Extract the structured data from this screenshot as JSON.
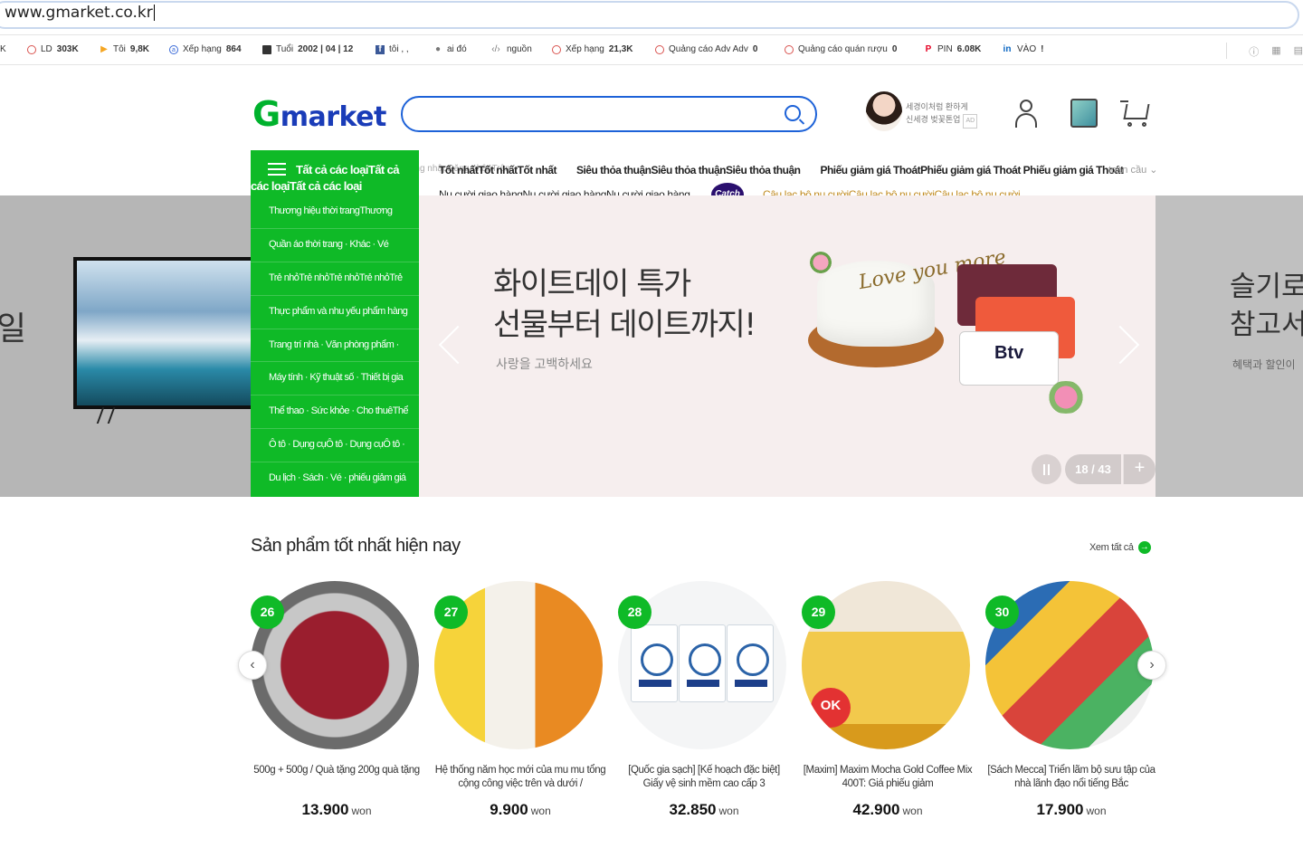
{
  "browser": {
    "url": "www.gmarket.co.kr",
    "bookmarks": [
      {
        "label": "LD",
        "value": "303K"
      },
      {
        "label": "Tôi",
        "value": "9,8K"
      },
      {
        "label": "Xếp hạng",
        "value": "864"
      },
      {
        "label": "Tuổi",
        "value": "2002 | 04 | 12"
      },
      {
        "label": "tôi , ,",
        "value": ""
      },
      {
        "label": "ai đó",
        "value": ""
      },
      {
        "label": "nguồn",
        "value": ""
      },
      {
        "label": "Xếp hạng",
        "value": "21,3K"
      },
      {
        "label": "Quảng cáo Adv Adv",
        "value": "0"
      },
      {
        "label": "Quảng cáo quán rượu",
        "value": "0"
      },
      {
        "label": "PIN",
        "value": "6.08K"
      },
      {
        "label": "VÀO",
        "value": "!"
      }
    ],
    "bookmark_first": "K"
  },
  "header": {
    "logo_g": "G",
    "logo_rest": "market",
    "search_placeholder": "",
    "ad": {
      "line1": "세경이처럼 환하게",
      "line2": "신세경 벚꽃톤업",
      "badge": "AD"
    }
  },
  "category": {
    "title": "Tất cả các loạiTất cả",
    "title2": "các loạiTất cả các loại",
    "items": [
      "Thương hiệu thời trangThương",
      "Quần áo thời trang · Khác · Vé",
      "Trẻ nhỏTrẻ nhỏTrẻ nhỏTrẻ nhỏTrẻ",
      "Thực phẩm và nhu yếu phẩm hàng",
      "Trang trí nhà · Văn phòng phẩm ·",
      "Máy tính · Kỹ thuật số · Thiết bị gia",
      "Thể thao · Sức khỏe · Cho thuêThể",
      "Ô tô · Dụng cụÔ tô · Dụng cụÔ tô ·",
      "Du lịch · Sách · Vé · phiếu giảm giá"
    ]
  },
  "topnav": {
    "ghost": "oopĐăng nhậpĐăng nhậpĐăng nhậpTrên",
    "items": [
      "Tốt nhấtTốt nhấtTốt nhất",
      "Siêu thỏa thuậnSiêu thỏa thuậnSiêu thỏa thuận",
      "Phiếu giảm giá ThoátPhiếu giảm giá Thoát Phiếu giảm giá Thoát"
    ],
    "right": "toàn cầu ⌄",
    "sub": "Nụ cười giao hàngNụ cười giao hàngNụ cười giao hàng",
    "catch": "Catch",
    "club": "Câu lạc bộ nụ cườiCâu lạc bộ nụ cườiCâu lạc bộ nụ cười"
  },
  "banner": {
    "left_text": "일",
    "headline1": "화이트데이 특가",
    "headline2": "선물부터 데이트까지!",
    "sub": "사랑을 고백하세요",
    "topper": "Love you more",
    "card_b": "Btv",
    "counter": "18 / 43",
    "plus": "+",
    "right_line1": "슬기로",
    "right_line2": "참고서",
    "right_sub": "혜택과 할인이"
  },
  "best": {
    "title": "Sản phẩm tốt nhất hiện nay",
    "see_all": "Xem tất cả",
    "products": [
      {
        "rank": "26",
        "name": "500g + 500g / Quà tặng 200g quà tặng",
        "price": "13.900",
        "unit": "won"
      },
      {
        "rank": "27",
        "name": "Hệ thống năm học mới của mu mu tổng cộng công việc trên và dưới /",
        "price": "9.900",
        "unit": "won"
      },
      {
        "rank": "28",
        "name": "[Quốc gia sạch] [Kế hoạch đặc biệt] Giấy vệ sinh mềm cao cấp 3",
        "price": "32.850",
        "unit": "won"
      },
      {
        "rank": "29",
        "name": "[Maxim] Maxim Mocha Gold Coffee Mix 400T: Giá phiếu giảm",
        "price": "42.900",
        "unit": "won"
      },
      {
        "rank": "30",
        "name": "[Sách Mecca] Triển lãm bộ sưu tập của nhà lãnh đạo nổi tiếng Bắc",
        "price": "17.900",
        "unit": "won"
      }
    ]
  },
  "icons": {
    "bm_circle": "ring-icon",
    "bm_play": "▶",
    "bm_fb": "f",
    "bm_in": "in",
    "bm_pin": "P",
    "accent": "#0fba27",
    "brand_blue": "#1d62d8"
  }
}
